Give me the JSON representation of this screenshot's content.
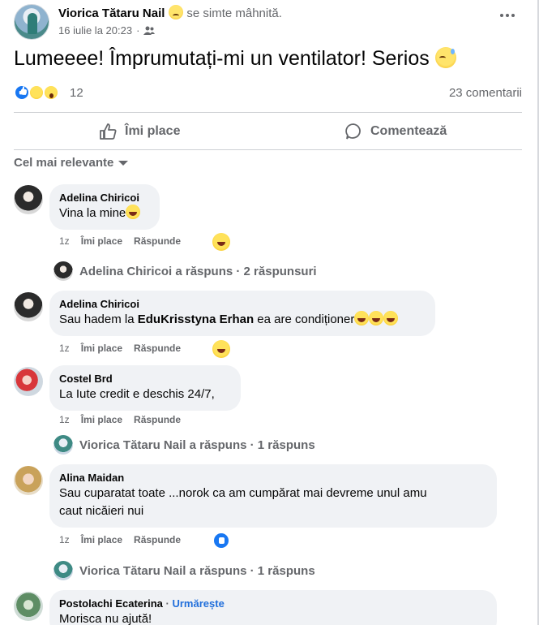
{
  "post": {
    "author": "Viorica Tătaru Nail",
    "feeling": "se simte mâhnită.",
    "timestamp": "16 iulie la 20:23",
    "audience_separator": "·",
    "text": "Lumeeee! Împrumutați-mi un ventilator! Serios",
    "reaction_count": "12",
    "comments_count": "23 comentarii",
    "icons": {
      "more": "more-dots-icon",
      "audience": "friends-icon"
    }
  },
  "actions": {
    "like": "Îmi place",
    "comment": "Comentează"
  },
  "sort_label": "Cel mai relevante",
  "comments": [
    {
      "name": "Adelina Chiricoi",
      "text": "Vina la mine",
      "age": "1z",
      "like": "Îmi place",
      "reply": "Răspunde",
      "replies_summary": "Adelina Chiricoi a răspuns · 2 răspunsuri"
    },
    {
      "name": "Adelina Chiricoi",
      "text_before": "Sau hadem la ",
      "mention": "EduKrisstyna Erhan",
      "text_after": " ea are condiționer",
      "age": "1z",
      "like": "Îmi place",
      "reply": "Răspunde"
    },
    {
      "name": "Costel Brd",
      "text": "La Iute credit e deschis 24/7,",
      "age": "1z",
      "like": "Îmi place",
      "reply": "Răspunde",
      "replies_summary": "Viorica Tătaru Nail a răspuns · 1 răspuns"
    },
    {
      "name": "Alina Maidan",
      "text_line1": "Sau cuparatat toate ...norok ca am cumpărat mai devreme unul amu",
      "text_line2": "caut nicăieri nui",
      "age": "1z",
      "like": "Îmi place",
      "reply": "Răspunde",
      "replies_summary": "Viorica Tătaru Nail a răspuns · 1 răspuns"
    },
    {
      "name": "Postolachi Ecaterina",
      "separator": "·",
      "follow": "Urmărește",
      "text": "Morisca nu ajută!"
    }
  ]
}
